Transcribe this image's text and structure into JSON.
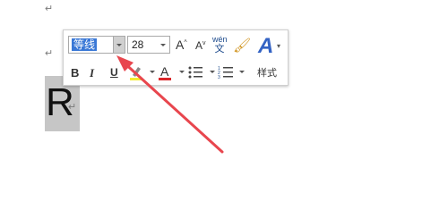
{
  "doc": {
    "paragraph_mark": "↵",
    "selected_text": "R"
  },
  "toolbar": {
    "font_name": "等线",
    "font_size": "28",
    "grow_font": "A",
    "shrink_font": "A",
    "phonetic_top": "wén",
    "phonetic_bottom": "文",
    "bold": "B",
    "italic": "I",
    "underline": "U",
    "font_color_letter": "A",
    "styles_label": "样式",
    "styles_letter": "A"
  },
  "colors": {
    "selection_bg": "#c6c6c6",
    "font_name_highlight": "#3a78d6",
    "arrow": "#e8464e",
    "font_color_bar": "#d9262a",
    "styles_accent": "#3463c4"
  }
}
